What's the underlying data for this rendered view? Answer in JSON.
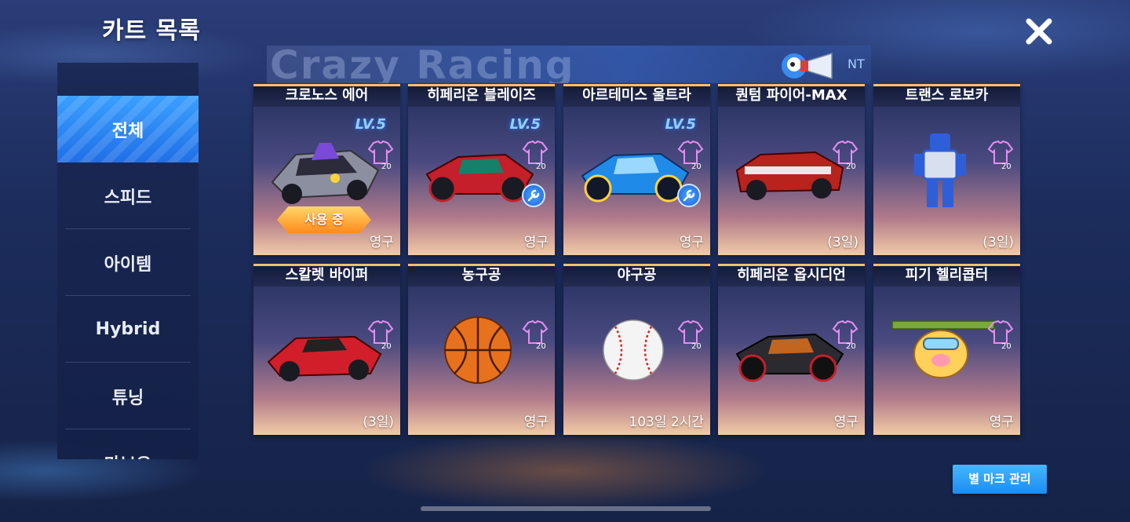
{
  "header": {
    "title": "카트 목록",
    "banner_text": "Crazy Racing",
    "banner_tag": "NT"
  },
  "sidebar": {
    "items": [
      {
        "label": "전체",
        "active": true
      },
      {
        "label": "스피드",
        "active": false
      },
      {
        "label": "아이템",
        "active": false
      },
      {
        "label": "Hybrid",
        "active": false
      },
      {
        "label": "튜닝",
        "active": false
      },
      {
        "label": "마보유",
        "active": false
      }
    ]
  },
  "karts": [
    {
      "name": "크로노스 에어",
      "level": "LV.5",
      "shirt_count": "20",
      "duration": "영구",
      "in_use_label": "사용 중",
      "icon": "silver-racing-kart"
    },
    {
      "name": "히페리온 블레이즈",
      "level": "LV.5",
      "shirt_count": "20",
      "duration": "영구",
      "tunable": true,
      "icon": "red-sport-kart"
    },
    {
      "name": "아르테미스 울트라",
      "level": "LV.5",
      "shirt_count": "20",
      "duration": "영구",
      "tunable": true,
      "icon": "blue-sport-kart"
    },
    {
      "name": "퀀텀 파이어-MAX",
      "shirt_count": "20",
      "duration": "(3일)",
      "icon": "red-muscle-car"
    },
    {
      "name": "트랜스 로보카",
      "shirt_count": "20",
      "duration": "(3일)",
      "icon": "robot-car"
    },
    {
      "name": "스칼렛 바이퍼",
      "shirt_count": "20",
      "duration": "(3일)",
      "icon": "red-supercar"
    },
    {
      "name": "농구공",
      "shirt_count": "20",
      "duration": "영구",
      "icon": "basketball"
    },
    {
      "name": "야구공",
      "shirt_count": "20",
      "duration": "103일 2시간",
      "icon": "baseball"
    },
    {
      "name": "히페리온 옵시디언",
      "shirt_count": "20",
      "duration": "영구",
      "icon": "black-sport-kart"
    },
    {
      "name": "피기 헬리콥터",
      "shirt_count": "20",
      "duration": "영구",
      "icon": "pig-helicopter"
    }
  ],
  "footer": {
    "star_mark_button": "별 마크 관리"
  },
  "colors": {
    "accent_blue": "#1f6fe6",
    "card_border": "#ffc06a",
    "in_use_orange": "#ff8a1c"
  }
}
